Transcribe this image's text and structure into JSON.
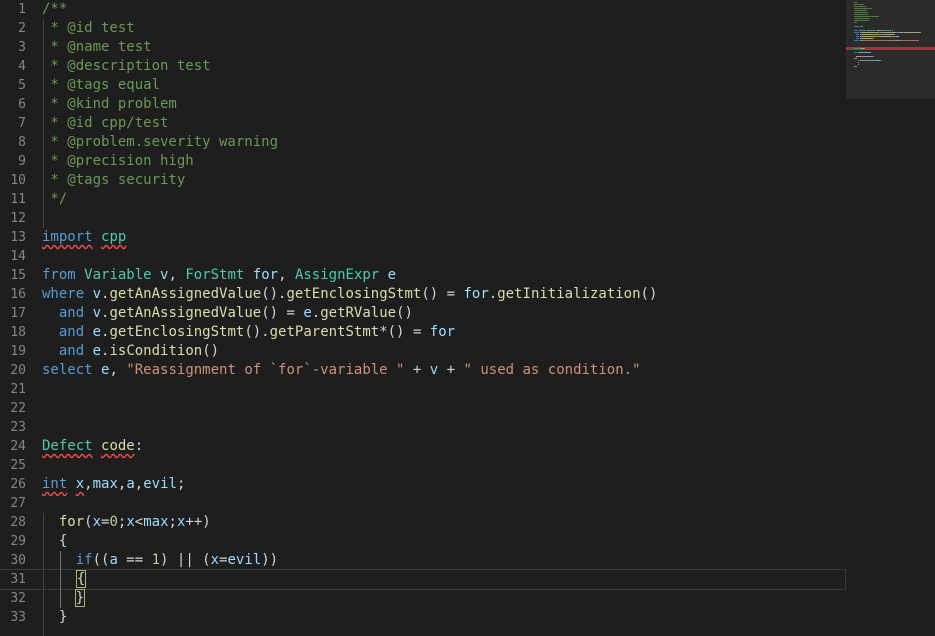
{
  "editor": {
    "language": "ql",
    "cursor_line": 31,
    "lines": [
      {
        "n": "1",
        "tokens": [
          [
            "/**",
            "comment"
          ]
        ]
      },
      {
        "n": "2",
        "tokens": [
          [
            " * @id test",
            "comment"
          ]
        ]
      },
      {
        "n": "3",
        "tokens": [
          [
            " * @name test",
            "comment"
          ]
        ]
      },
      {
        "n": "4",
        "tokens": [
          [
            " * @description test",
            "comment"
          ]
        ]
      },
      {
        "n": "5",
        "tokens": [
          [
            " * @tags equal",
            "comment"
          ]
        ]
      },
      {
        "n": "6",
        "tokens": [
          [
            " * @kind problem",
            "comment"
          ]
        ]
      },
      {
        "n": "7",
        "tokens": [
          [
            " * @id cpp/test",
            "comment"
          ]
        ]
      },
      {
        "n": "8",
        "tokens": [
          [
            " * @problem.severity warning",
            "comment"
          ]
        ]
      },
      {
        "n": "9",
        "tokens": [
          [
            " * @precision high",
            "comment"
          ]
        ]
      },
      {
        "n": "10",
        "tokens": [
          [
            " * @tags security",
            "comment"
          ]
        ]
      },
      {
        "n": "11",
        "tokens": [
          [
            " */",
            "comment"
          ]
        ]
      },
      {
        "n": "12",
        "tokens": []
      },
      {
        "n": "13",
        "tokens": [
          [
            "import",
            "keyword squiggle"
          ],
          [
            " ",
            "plain"
          ],
          [
            "cpp",
            "type squiggle"
          ]
        ]
      },
      {
        "n": "14",
        "tokens": []
      },
      {
        "n": "15",
        "tokens": [
          [
            "from",
            "keyword"
          ],
          [
            " ",
            "plain"
          ],
          [
            "Variable",
            "type"
          ],
          [
            " ",
            "plain"
          ],
          [
            "v",
            "var"
          ],
          [
            ", ",
            "plain"
          ],
          [
            "ForStmt",
            "type"
          ],
          [
            " ",
            "plain"
          ],
          [
            "for",
            "var"
          ],
          [
            ", ",
            "plain"
          ],
          [
            "AssignExpr",
            "type"
          ],
          [
            " ",
            "plain"
          ],
          [
            "e",
            "var"
          ]
        ]
      },
      {
        "n": "16",
        "tokens": [
          [
            "where",
            "keyword"
          ],
          [
            " ",
            "plain"
          ],
          [
            "v",
            "var"
          ],
          [
            ".",
            "plain"
          ],
          [
            "getAnAssignedValue",
            "fn"
          ],
          [
            "().",
            "plain"
          ],
          [
            "getEnclosingStmt",
            "fn"
          ],
          [
            "() = ",
            "plain"
          ],
          [
            "for",
            "var"
          ],
          [
            ".",
            "plain"
          ],
          [
            "getInitialization",
            "fn"
          ],
          [
            "()",
            "plain"
          ]
        ]
      },
      {
        "n": "17",
        "tokens": [
          [
            "  ",
            "plain"
          ],
          [
            "and",
            "keyword"
          ],
          [
            " ",
            "plain"
          ],
          [
            "v",
            "var"
          ],
          [
            ".",
            "plain"
          ],
          [
            "getAnAssignedValue",
            "fn"
          ],
          [
            "() = ",
            "plain"
          ],
          [
            "e",
            "var"
          ],
          [
            ".",
            "plain"
          ],
          [
            "getRValue",
            "fn"
          ],
          [
            "()",
            "plain"
          ]
        ]
      },
      {
        "n": "18",
        "tokens": [
          [
            "  ",
            "plain"
          ],
          [
            "and",
            "keyword"
          ],
          [
            " ",
            "plain"
          ],
          [
            "e",
            "var"
          ],
          [
            ".",
            "plain"
          ],
          [
            "getEnclosingStmt",
            "fn"
          ],
          [
            "().",
            "plain"
          ],
          [
            "getParentStmt",
            "fn"
          ],
          [
            "*() = ",
            "plain"
          ],
          [
            "for",
            "var"
          ]
        ]
      },
      {
        "n": "19",
        "tokens": [
          [
            "  ",
            "plain"
          ],
          [
            "and",
            "keyword"
          ],
          [
            " ",
            "plain"
          ],
          [
            "e",
            "var"
          ],
          [
            ".",
            "plain"
          ],
          [
            "isCondition",
            "fn"
          ],
          [
            "()",
            "plain"
          ]
        ]
      },
      {
        "n": "20",
        "tokens": [
          [
            "select",
            "keyword"
          ],
          [
            " ",
            "plain"
          ],
          [
            "e",
            "var"
          ],
          [
            ", ",
            "plain"
          ],
          [
            "\"Reassignment of `for`-variable \"",
            "str"
          ],
          [
            " + ",
            "plain"
          ],
          [
            "v",
            "var"
          ],
          [
            " + ",
            "plain"
          ],
          [
            "\" used as condition.\"",
            "str"
          ]
        ]
      },
      {
        "n": "21",
        "tokens": []
      },
      {
        "n": "22",
        "tokens": []
      },
      {
        "n": "23",
        "tokens": []
      },
      {
        "n": "24",
        "tokens": [
          [
            "Defect",
            "type squiggle"
          ],
          [
            " ",
            "plain"
          ],
          [
            "code",
            "fn squiggle"
          ],
          [
            ":",
            "plain"
          ]
        ]
      },
      {
        "n": "25",
        "tokens": []
      },
      {
        "n": "26",
        "tokens": [
          [
            "int",
            "keyword squiggle"
          ],
          [
            " ",
            "plain"
          ],
          [
            "x",
            "var squiggle"
          ],
          [
            ",",
            "plain"
          ],
          [
            "max",
            "var"
          ],
          [
            ",",
            "plain"
          ],
          [
            "a",
            "var"
          ],
          [
            ",",
            "plain"
          ],
          [
            "evil",
            "var"
          ],
          [
            ";",
            "plain"
          ]
        ]
      },
      {
        "n": "27",
        "tokens": []
      },
      {
        "n": "28",
        "tokens": [
          [
            "  ",
            "plain"
          ],
          [
            "for",
            "fn"
          ],
          [
            "(",
            "plain"
          ],
          [
            "x",
            "var"
          ],
          [
            "=",
            "plain"
          ],
          [
            "0",
            "num"
          ],
          [
            ";",
            "plain"
          ],
          [
            "x",
            "var"
          ],
          [
            "<",
            "plain"
          ],
          [
            "max",
            "var"
          ],
          [
            ";",
            "plain"
          ],
          [
            "x",
            "var"
          ],
          [
            "++)",
            "plain"
          ]
        ]
      },
      {
        "n": "29",
        "tokens": [
          [
            "  {",
            "plain"
          ]
        ]
      },
      {
        "n": "30",
        "tokens": [
          [
            "    ",
            "plain"
          ],
          [
            "if",
            "keyword"
          ],
          [
            "((",
            "plain"
          ],
          [
            "a",
            "var"
          ],
          [
            " == ",
            "plain"
          ],
          [
            "1",
            "num"
          ],
          [
            ") || (",
            "plain"
          ],
          [
            "x",
            "var"
          ],
          [
            "=",
            "plain"
          ],
          [
            "evil",
            "var"
          ],
          [
            "))",
            "plain"
          ]
        ]
      },
      {
        "n": "31",
        "tokens": [
          [
            "    ",
            "plain"
          ],
          [
            "{",
            "plain bracket-match"
          ]
        ]
      },
      {
        "n": "32",
        "tokens": [
          [
            "    ",
            "plain"
          ],
          [
            "}",
            "plain bracket-match"
          ]
        ]
      },
      {
        "n": "33",
        "tokens": [
          [
            "  }",
            "plain"
          ]
        ]
      }
    ]
  },
  "colors": {
    "background": "#1e1e1e",
    "comment": "#6a9955",
    "keyword": "#569cd6",
    "type": "#4ec9b0",
    "variable": "#9cdcfe",
    "function": "#dcdcaa",
    "string": "#ce9178",
    "number": "#b5cea8",
    "line_number": "#858585",
    "error_squiggle": "#f14c4c",
    "minimap_highlight": "#b3373a"
  }
}
